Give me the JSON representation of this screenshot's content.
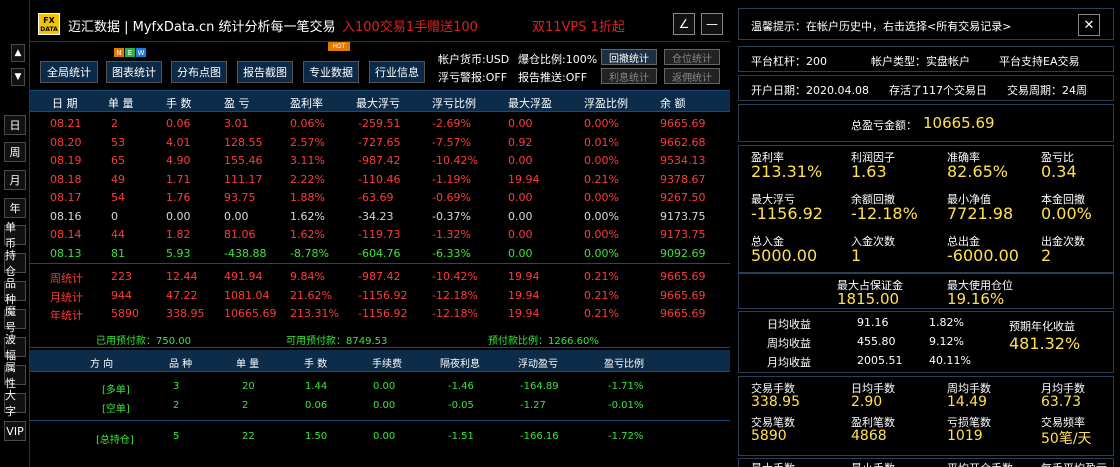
{
  "sidebar": {
    "arrow_up": "▲",
    "arrow_down": "▼",
    "items": [
      "日",
      "周",
      "月",
      "年",
      "单币",
      "持仓",
      "品种",
      "魔号",
      "波幅",
      "属性",
      "大字",
      "VIP"
    ]
  },
  "titlebar": {
    "logo_top": "FX",
    "logo_bottom": "DATA",
    "title": "迈汇数据 | MyfxData.cn  统计分析每一笔交易",
    "promo1": "入100交易1手赠送100",
    "promo2": "双11VPS 1折起",
    "edit_icon": "∠",
    "minimize_icon": "—"
  },
  "toolbar": {
    "buttons": [
      "全局统计",
      "图表统计",
      "分布点图",
      "报告截图",
      "专业数据",
      "行业信息"
    ],
    "badges": [
      "N",
      "E",
      "W"
    ],
    "hot": "HOT",
    "account_currency": "帐户货币:USD",
    "max_ratio": "爆仓比例:100%",
    "float_warn": "浮亏警报:OFF",
    "report_push": "报告推送:OFF",
    "btn_withdraw": "回撤统计",
    "btn_position": "仓位统计",
    "btn_interest": "利息统计",
    "btn_rebate": "返佣统计"
  },
  "grid": {
    "headers": [
      "日 期",
      "单 量",
      "手 数",
      "盈 亏",
      "盈利率",
      "最大浮亏",
      "浮亏比例",
      "最大浮盈",
      "浮盈比例",
      "余 额"
    ],
    "rows": [
      {
        "c": "red",
        "v": [
          "08.21",
          "2",
          "0.06",
          "3.01",
          "0.06%",
          "-259.51",
          "-2.69%",
          "0.00",
          "0.00%",
          "9665.69"
        ]
      },
      {
        "c": "red",
        "v": [
          "08.20",
          "53",
          "4.01",
          "128.55",
          "2.57%",
          "-727.65",
          "-7.57%",
          "0.92",
          "0.01%",
          "9662.68"
        ]
      },
      {
        "c": "red",
        "v": [
          "08.19",
          "65",
          "4.90",
          "155.46",
          "3.11%",
          "-987.42",
          "-10.42%",
          "0.00",
          "0.00%",
          "9534.13"
        ]
      },
      {
        "c": "red",
        "v": [
          "08.18",
          "49",
          "1.71",
          "111.17",
          "2.22%",
          "-110.46",
          "-1.19%",
          "19.94",
          "0.21%",
          "9378.67"
        ]
      },
      {
        "c": "red",
        "v": [
          "08.17",
          "54",
          "1.76",
          "93.75",
          "1.88%",
          "-63.69",
          "-0.69%",
          "0.00",
          "0.00%",
          "9267.50"
        ]
      },
      {
        "c": "white",
        "v": [
          "08.16",
          "0",
          "0.00",
          "0.00",
          "1.62%",
          "-34.23",
          "-0.37%",
          "0.00",
          "0.00%",
          "9173.75"
        ]
      },
      {
        "c": "red",
        "v": [
          "08.14",
          "44",
          "1.82",
          "81.06",
          "1.62%",
          "-119.73",
          "-1.32%",
          "0.00",
          "0.00%",
          "9173.75"
        ]
      },
      {
        "c": "green",
        "v": [
          "08.13",
          "81",
          "5.93",
          "-438.88",
          "-8.78%",
          "-604.76",
          "-6.33%",
          "0.00",
          "0.00%",
          "9092.69"
        ]
      }
    ],
    "totals": [
      [
        "周统计",
        "223",
        "12.44",
        "491.94",
        "9.84%",
        "-987.42",
        "-10.42%",
        "19.94",
        "0.21%",
        "9665.69"
      ],
      [
        "月统计",
        "944",
        "47.22",
        "1081.04",
        "21.62%",
        "-1156.92",
        "-12.18%",
        "19.94",
        "0.21%",
        "9665.69"
      ],
      [
        "年统计",
        "5890",
        "338.95",
        "10665.69",
        "213.31%",
        "-1156.92",
        "-12.18%",
        "19.94",
        "0.21%",
        "9665.69"
      ]
    ]
  },
  "summary": {
    "used_margin": "已用预付款：750.00",
    "free_margin": "可用预付款：8749.53",
    "margin_ratio": "预付款比例：1266.60%"
  },
  "positions": {
    "headers": [
      "方 向",
      "品 种",
      "单 量",
      "手 数",
      "手续费",
      "隔夜利息",
      "浮动盈亏",
      "盈亏比例"
    ],
    "rows": [
      [
        "[多单]",
        "3",
        "20",
        "1.44",
        "0.00",
        "-1.46",
        "-164.89",
        "-1.71%"
      ],
      [
        "[空单]",
        "2",
        "2",
        "0.06",
        "0.00",
        "-0.05",
        "-1.27",
        "-0.01%"
      ]
    ],
    "total": [
      "[总持仓]",
      "5",
      "22",
      "1.50",
      "0.00",
      "-1.51",
      "-166.16",
      "-1.72%"
    ]
  },
  "right": {
    "tip": "温馨提示：在帐户历史中，右击选择<所有交易记录>",
    "close_icon": "✕",
    "leverage": "平台杠杆：200",
    "account_type": "帐户类型：实盘帐户",
    "ea": "平台支持EA交易",
    "open_date": "开户日期：2020.04.08",
    "days": "存活了117个交易日",
    "cycle": "交易周期：24周",
    "total_pl_label": "总盈亏金额：",
    "total_pl_value": "10665.69",
    "stats": [
      [
        {
          "l": "盈利率",
          "v": "213.31%"
        },
        {
          "l": "利润因子",
          "v": "1.63"
        },
        {
          "l": "准确率",
          "v": "82.65%"
        },
        {
          "l": "盈亏比",
          "v": "0.34"
        }
      ],
      [
        {
          "l": "最大浮亏",
          "v": "-1156.92"
        },
        {
          "l": "余额回撤",
          "v": "-12.18%"
        },
        {
          "l": "最小净值",
          "v": "7721.98"
        },
        {
          "l": "本金回撤",
          "v": "0.00%"
        }
      ],
      [
        {
          "l": "总入金",
          "v": "5000.00"
        },
        {
          "l": "入金次数",
          "v": "1"
        },
        {
          "l": "总出金",
          "v": "-6000.00"
        },
        {
          "l": "出金次数",
          "v": "2"
        }
      ]
    ],
    "max_margin_label": "最大占保证金",
    "max_margin_value": "1815.00",
    "max_pos_label": "最大使用仓位",
    "max_pos_value": "19.16%",
    "income": [
      {
        "l": "日均收益",
        "v": "91.16",
        "p": "1.82%"
      },
      {
        "l": "周均收益",
        "v": "455.80",
        "p": "9.12%"
      },
      {
        "l": "月均收益",
        "v": "2005.51",
        "p": "40.11%"
      }
    ],
    "annual_label": "预期年化收益",
    "annual_value": "481.32%",
    "trade_stats": [
      [
        {
          "l": "交易手数",
          "v": "338.95"
        },
        {
          "l": "日均手数",
          "v": "2.90"
        },
        {
          "l": "周均手数",
          "v": "14.49"
        },
        {
          "l": "月均手数",
          "v": "63.73"
        }
      ],
      [
        {
          "l": "交易笔数",
          "v": "5890"
        },
        {
          "l": "盈利笔数",
          "v": "4868"
        },
        {
          "l": "亏损笔数",
          "v": "1019"
        },
        {
          "l": "交易频率",
          "v": "50笔/天"
        }
      ]
    ],
    "bottom_cut": [
      "最大手数",
      "最小手数",
      "平均开仓手数",
      "每手平均盈亏"
    ]
  },
  "colors": {
    "accent": "#0c2c4a",
    "profit": "#ff3b3b",
    "loss": "#39e639",
    "highlight": "#ffe14d"
  }
}
